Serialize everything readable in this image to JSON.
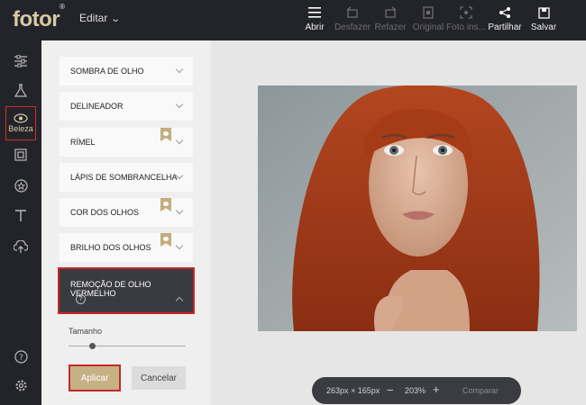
{
  "app": {
    "logo": "fotor",
    "logo_mark": "®",
    "menu_label": "Editar"
  },
  "toolbar": [
    {
      "label": "Abrir",
      "icon": "menu-icon",
      "enabled": true
    },
    {
      "label": "Desfazer",
      "icon": "undo-icon",
      "enabled": false
    },
    {
      "label": "Refazer",
      "icon": "redo-icon",
      "enabled": false
    },
    {
      "label": "Original",
      "icon": "original-icon",
      "enabled": false
    },
    {
      "label": "Foto ins...",
      "icon": "photo-info-icon",
      "enabled": false
    },
    {
      "label": "Partilhar",
      "icon": "share-icon",
      "enabled": true
    },
    {
      "label": "Salvar",
      "icon": "save-icon",
      "enabled": true
    }
  ],
  "rail": {
    "items": [
      "adjust-icon",
      "effects-icon",
      "beauty-icon",
      "frame-icon",
      "sticker-icon",
      "text-icon",
      "upload-icon"
    ],
    "active_label": "Beleza",
    "bottom": [
      "help-icon",
      "settings-icon"
    ]
  },
  "panel": {
    "items": [
      {
        "label": "SOMBRA DE OLHO",
        "premium": false
      },
      {
        "label": "DELINEADOR",
        "premium": false
      },
      {
        "label": "RÍMEL",
        "premium": true
      },
      {
        "label": "LÁPIS DE SOMBRANCELHA",
        "premium": false
      },
      {
        "label": "COR DOS OLHOS",
        "premium": true
      },
      {
        "label": "BRILHO DOS OLHOS",
        "premium": true
      },
      {
        "label": "REMOÇÃO DE OLHO VERMELHO",
        "premium": false,
        "expanded": true
      }
    ],
    "help_glyph": "?",
    "size_label": "Tamanho",
    "size_value": 0.2,
    "apply_label": "Aplicar",
    "cancel_label": "Cancelar"
  },
  "zoom": {
    "dimensions": "263px × 165px",
    "minus": "−",
    "level": "203%",
    "plus": "+",
    "compare": "Comparar"
  },
  "colors": {
    "accent": "#c6b184",
    "highlight": "#cc2626",
    "dark": "#23242a"
  }
}
